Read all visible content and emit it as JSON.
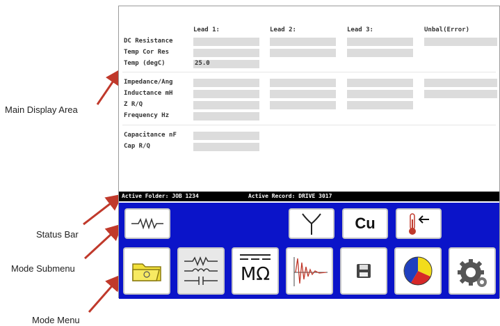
{
  "callouts": {
    "main_display": "Main Display Area",
    "status_bar": "Status Bar",
    "mode_submenu": "Mode Submenu",
    "mode_menu": "Mode Menu"
  },
  "table": {
    "headers": [
      "Lead 1:",
      "Lead 2:",
      "Lead 3:",
      "Unbal(Error)"
    ],
    "rows": [
      "DC Resistance",
      "Temp Cor Res",
      "Temp (degC)",
      "Impedance/Ang",
      "Inductance mH",
      "Z R/Q",
      "Frequency Hz",
      "Capacitance nF",
      "Cap R/Q"
    ],
    "temp_value": "25.0"
  },
  "status": {
    "active_folder": "Active Folder: JOB 1234",
    "active_record": "Active Record: DRIVE 3017"
  },
  "icons": {
    "submenu": [
      "resistor-wave-icon",
      "wye-connection-icon",
      "copper-cu-icon",
      "thermometer-input-icon"
    ],
    "submenu_text_cu": "Cu",
    "menu": [
      "folder-icon",
      "circuit-mode-icon",
      "megohm-icon",
      "waveform-icon",
      "save-icon",
      "pie-chart-icon",
      "settings-gear-icon"
    ],
    "megohm_text": "MΩ"
  },
  "colors": {
    "menu_bg": "#0b14c9",
    "status_bg": "#000000",
    "field_bg": "#dcdcdc",
    "callout_arrow": "#c0392b"
  }
}
